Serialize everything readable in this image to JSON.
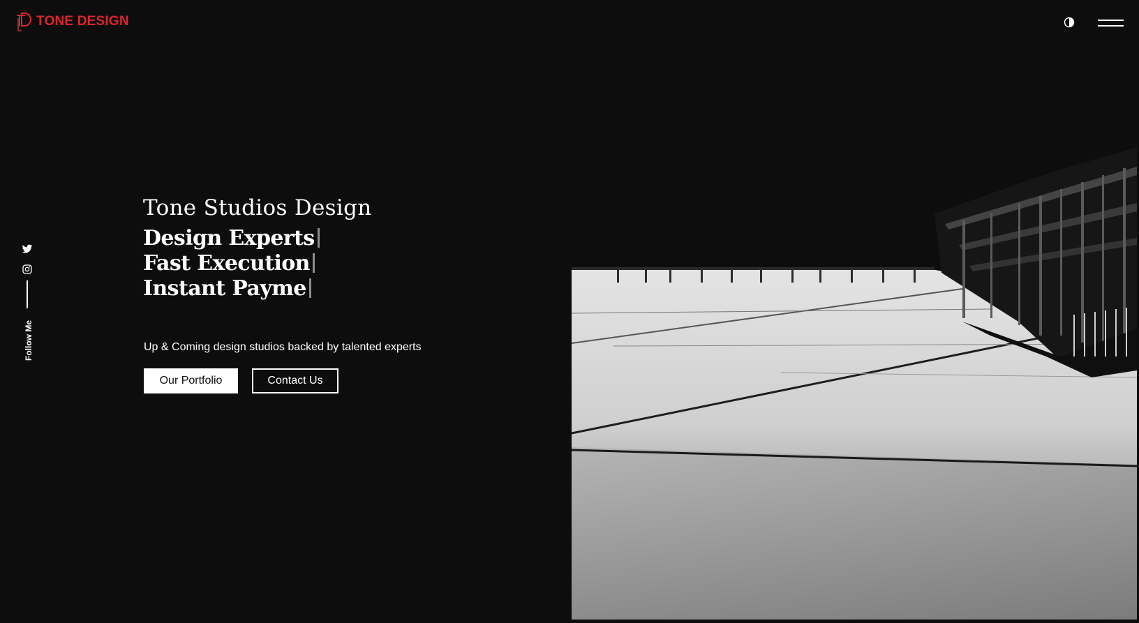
{
  "header": {
    "brand": "TONE DESIGN",
    "brand_color": "#d9262c",
    "theme_toggle_icon": "half-circle-contrast-icon",
    "menu_icon": "hamburger-menu-icon"
  },
  "social": {
    "items": [
      {
        "icon": "twitter-icon"
      },
      {
        "icon": "instagram-icon"
      }
    ],
    "label": "Follow Me"
  },
  "hero": {
    "title": "Tone Studios Design",
    "lines": [
      "Design Experts",
      "Fast Execution",
      "Instant Payme"
    ],
    "subtitle": "Up & Coming design studios backed by talented experts",
    "primary_button": "Our Portfolio",
    "secondary_button": "Contact Us",
    "image": "black-and-white-architecture-photo"
  }
}
